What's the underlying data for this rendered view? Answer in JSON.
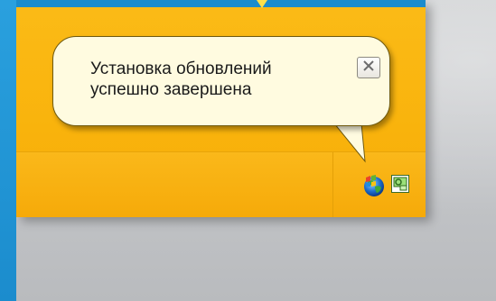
{
  "notification": {
    "message_line1": "Установка обновлений",
    "message_line2": "успешно завершена",
    "close_label": "X"
  },
  "tray": {
    "icons": [
      "windows-update-globe-icon",
      "network-icon"
    ]
  },
  "colors": {
    "outer_frame": "#1b8ccd",
    "window_bg": "#f9b30c",
    "balloon_bg": "#fffbe0",
    "desktop_bg": "#c3c5c8"
  }
}
